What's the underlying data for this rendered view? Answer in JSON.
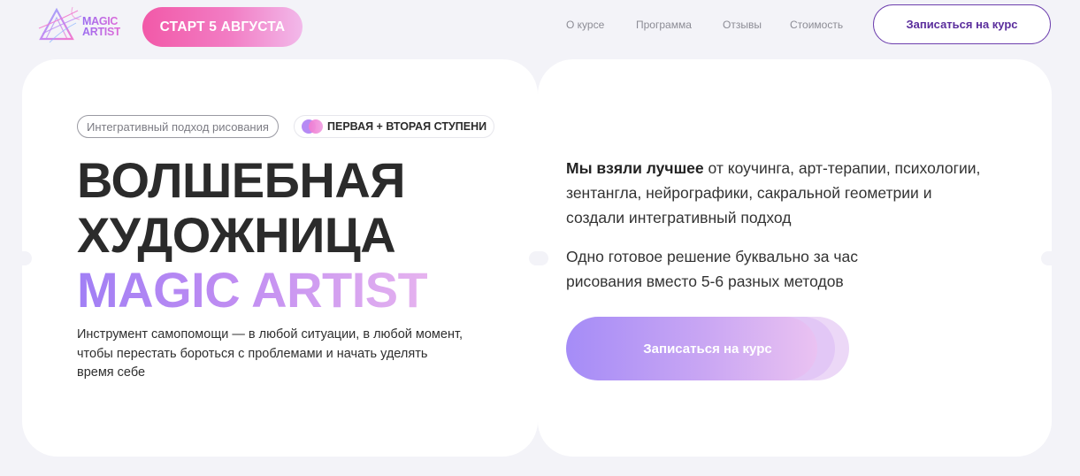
{
  "header": {
    "logo_text": "MAGIC ARTIST",
    "start_label": "СТАРТ 5 АВГУСТА",
    "nav": [
      "О курсе",
      "Программа",
      "Отзывы",
      "Стоимость"
    ],
    "cta_label": "Записаться на курс"
  },
  "hero": {
    "tag_approach": "Интегративный подход рисования",
    "tag_steps": "ПЕРВАЯ + ВТОРАЯ СТУПЕНИ",
    "headline_line1": "ВОЛШЕБНАЯ",
    "headline_line2": "ХУДОЖНИЦА",
    "headline_line3": "MAGIC ARTIST",
    "subtext": "Инструмент самопомощи — в любой ситуации, в любой момент, чтобы перестать бороться с проблемами и начать уделять время себе"
  },
  "right": {
    "p1_bold": "Мы взяли лучшее",
    "p1_rest": " от коучинга, арт-терапии, психологии, зентангла, нейрографики, сакральной геометрии и создали интегративный подход",
    "p2": "Одно готовое решение буквально за час рисования вместо 5-6 разных методов",
    "cta_label": "Записаться на курс"
  },
  "colors": {
    "accent_pink": "#f259a8",
    "accent_purple": "#6d3fae",
    "gradient_violet": "#a58cf7",
    "background": "#f3f3f8"
  },
  "icons": {
    "logo": "triangle-logo-icon",
    "steps": "two-dots-icon"
  }
}
